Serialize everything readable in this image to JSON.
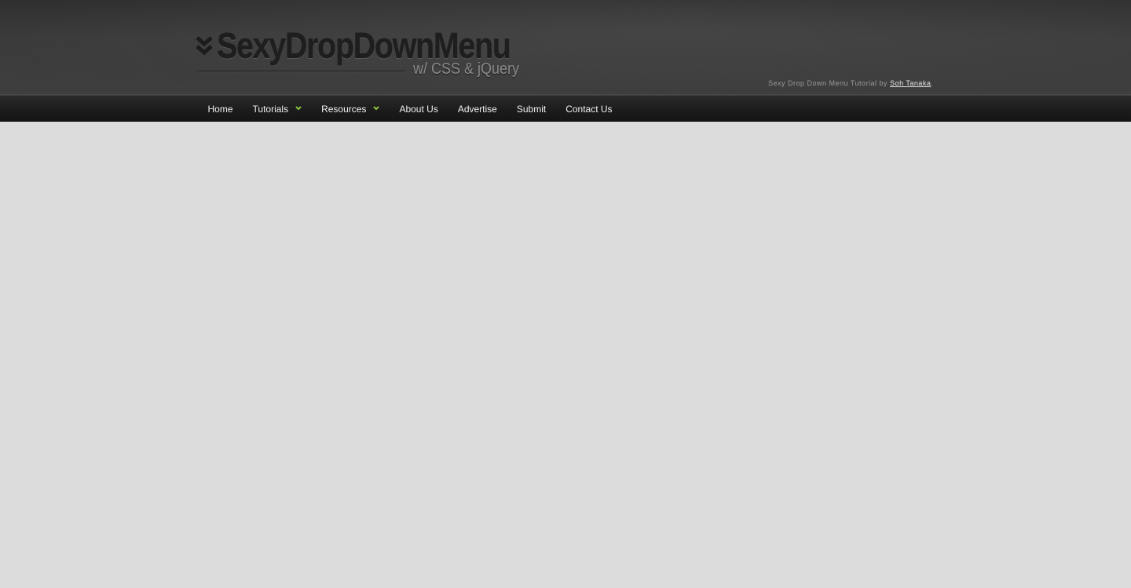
{
  "header": {
    "logo_title": "SexyDropDownMenu",
    "logo_subtitle": "w/ CSS & jQuery",
    "credit_prefix": "Sexy Drop Down Menu Tutorial by ",
    "credit_author": "Soh Tanaka",
    "credit_suffix": "."
  },
  "nav": {
    "items": [
      {
        "label": "Home",
        "has_dropdown": false
      },
      {
        "label": "Tutorials",
        "has_dropdown": true
      },
      {
        "label": "Resources",
        "has_dropdown": true
      },
      {
        "label": "About Us",
        "has_dropdown": false
      },
      {
        "label": "Advertise",
        "has_dropdown": false
      },
      {
        "label": "Submit",
        "has_dropdown": false
      },
      {
        "label": "Contact Us",
        "has_dropdown": false
      }
    ],
    "caret_icon": "chevron-down-icon",
    "caret_color": "#8cc63f"
  },
  "colors": {
    "header_bg": "#333333",
    "nav_bg": "#1b1b1b",
    "body_bg": "#dcdcdc",
    "accent": "#8cc63f"
  }
}
